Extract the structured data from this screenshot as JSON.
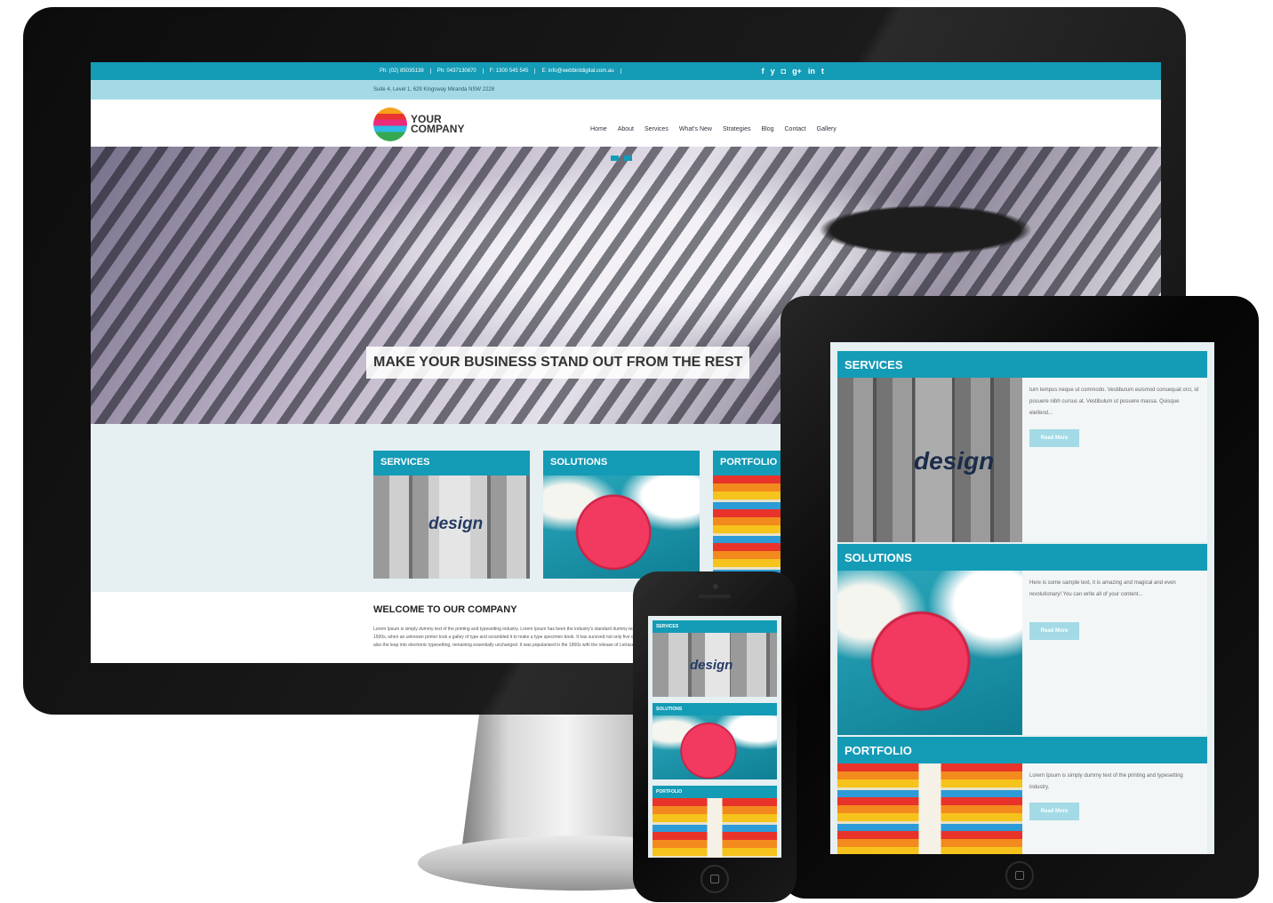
{
  "desktop": {
    "topbar": {
      "contacts": [
        "Ph: (02) 85035138",
        "Ph: 0437130870",
        "F: 1300 545 545",
        "E: info@webbirddigital.com.au"
      ],
      "socials": [
        "f",
        "y",
        "◘",
        "g+",
        "in",
        "t"
      ]
    },
    "address": "Suite 4, Level 1, 629 Kingsway Miranda NSW 2228",
    "logo": {
      "text": "YOUR COMPANY"
    },
    "nav": [
      "Home",
      "About",
      "Services",
      "What's New",
      "Strategies",
      "Blog",
      "Contact",
      "Gallery"
    ],
    "hero": {
      "caption": "MAKE YOUR BUSINESS STAND OUT FROM THE REST"
    },
    "panels": [
      {
        "title": "SERVICES",
        "image": "design-blocks"
      },
      {
        "title": "SOLUTIONS",
        "image": "red-umbrella"
      },
      {
        "title": "PORTFOLIO",
        "image": "colored-pencils"
      }
    ],
    "welcome": {
      "heading": "WELCOME TO OUR COMPANY",
      "body": "Lorem Ipsum is simply dummy text of the printing and typesetting industry. Lorem Ipsum has been the industry's standard dummy text ever since the 1500s, when an unknown printer took a galley of type and scrambled it to make a type specimen book. It has survived not only five centuries, but also the leap into electronic typesetting, remaining essentially unchanged. It was popularised in the 1960s with the release of Letraset sheets."
    }
  },
  "tablet": {
    "blocks": [
      {
        "title": "SERVICES",
        "text": "tum tempus neque ut commodo. Vestibulum euismod consequat orci, id posuere nibh cursus at. Vestibulum ut posuere massa. Quisque eleifend...",
        "button": "Read More",
        "image": "design-blocks"
      },
      {
        "title": "SOLUTIONS",
        "text": "Here is some sample text, it is amazing and magical and even revolutionary! You can write all of your content...",
        "button": "Read More",
        "image": "red-umbrella"
      },
      {
        "title": "PORTFOLIO",
        "text": "Lorem Ipsum is simply dummy text of the printing and typesetting industry.",
        "button": "Read More",
        "image": "colored-pencils"
      }
    ]
  },
  "phone": {
    "blocks": [
      {
        "title": "SERVICES",
        "image": "design-blocks"
      },
      {
        "title": "SOLUTIONS",
        "image": "red-umbrella"
      },
      {
        "title": "PORTFOLIO",
        "image": "colored-pencils"
      }
    ]
  },
  "image_word": "design",
  "colors": {
    "accent": "#149bb6",
    "accent_light": "#a4dae5",
    "panel_bg": "#e6eff1"
  }
}
